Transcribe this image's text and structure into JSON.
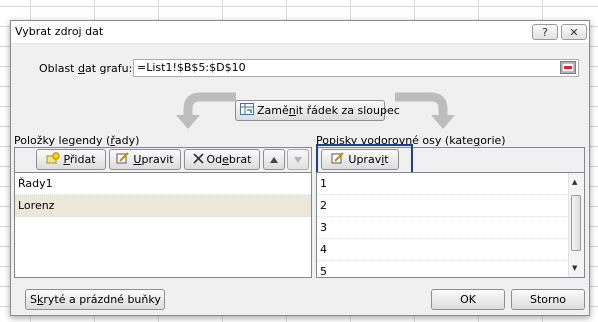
{
  "dialog": {
    "title": "Vybrat zdroj dat",
    "help_symbol": "?",
    "close_symbol": "✕"
  },
  "range": {
    "label_prefix": "Oblast ",
    "label_underline": "d",
    "label_suffix": "at grafu:",
    "value": "=List1!$B$5:$D$10"
  },
  "switch": {
    "label_prefix": "Zamě",
    "label_underline": "n",
    "label_suffix": "it řádek za sloupec"
  },
  "legend": {
    "title_prefix": "Položky legendy (",
    "title_underline": "ř",
    "title_suffix": "ady)",
    "add": {
      "prefix": "",
      "underline": "P",
      "suffix": "řidat"
    },
    "edit": {
      "prefix": "",
      "underline": "U",
      "suffix": "pravit"
    },
    "remove": {
      "prefix": "Od",
      "underline": "e",
      "suffix": "brat"
    },
    "items": [
      {
        "label": "Řady1",
        "selected": false
      },
      {
        "label": "Lorenz",
        "selected": true
      }
    ]
  },
  "axis": {
    "title_prefix": "Popisky vodorovné osy (kate",
    "title_underline": "g",
    "title_suffix": "orie)",
    "edit": {
      "prefix": "Uprav",
      "underline": "i",
      "suffix": "t"
    },
    "items": [
      "1",
      "2",
      "3",
      "4",
      "5"
    ]
  },
  "footer": {
    "hidden_prefix": "S",
    "hidden_underline": "k",
    "hidden_suffix": "ryté a prázdné buňky",
    "ok": "OK",
    "cancel": "Storno"
  }
}
